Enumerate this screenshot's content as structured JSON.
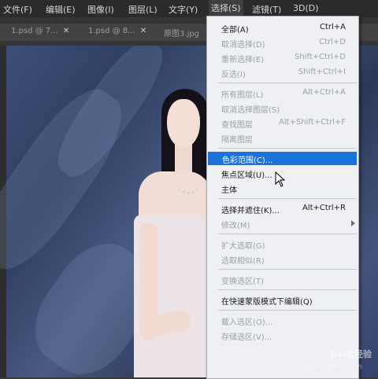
{
  "menubar": {
    "items": [
      "文件(F)",
      "编辑(E)",
      "图像(I)",
      "图层(L)",
      "文字(Y)",
      "选择(S)",
      "滤镜(T)",
      "3D(D)"
    ]
  },
  "tabs": [
    {
      "label": "1.psd @ 7..."
    },
    {
      "label": "1.psd @ 8..."
    },
    {
      "label": "原图3.jpg"
    }
  ],
  "select_menu": {
    "groups": [
      [
        {
          "label": "全部(A)",
          "shortcut": "Ctrl+A",
          "disabled": false
        },
        {
          "label": "取消选择(D)",
          "shortcut": "Ctrl+D",
          "disabled": true
        },
        {
          "label": "重新选择(E)",
          "shortcut": "Shift+Ctrl+D",
          "disabled": true
        },
        {
          "label": "反选(I)",
          "shortcut": "Shift+Ctrl+I",
          "disabled": true
        }
      ],
      [
        {
          "label": "所有图层(L)",
          "shortcut": "Alt+Ctrl+A",
          "disabled": true
        },
        {
          "label": "取消选择图层(S)",
          "shortcut": "",
          "disabled": true
        },
        {
          "label": "查找图层",
          "shortcut": "Alt+Shift+Ctrl+F",
          "disabled": true
        },
        {
          "label": "隔离图层",
          "shortcut": "",
          "disabled": true
        }
      ],
      [
        {
          "label": "色彩范围(C)...",
          "shortcut": "",
          "disabled": false,
          "selected": true
        },
        {
          "label": "焦点区域(U)...",
          "shortcut": "",
          "disabled": false
        },
        {
          "label": "主体",
          "shortcut": "",
          "disabled": false
        }
      ],
      [
        {
          "label": "选择并遮住(K)...",
          "shortcut": "Alt+Ctrl+R",
          "disabled": false
        },
        {
          "label": "修改(M)",
          "shortcut": "",
          "disabled": true,
          "submenu": true
        }
      ],
      [
        {
          "label": "扩大选取(G)",
          "shortcut": "",
          "disabled": true
        },
        {
          "label": "选取相似(R)",
          "shortcut": "",
          "disabled": true
        }
      ],
      [
        {
          "label": "变换选区(T)",
          "shortcut": "",
          "disabled": true
        }
      ],
      [
        {
          "label": "在快速蒙版模式下编辑(Q)",
          "shortcut": "",
          "disabled": false
        }
      ],
      [
        {
          "label": "载入选区(O)...",
          "shortcut": "",
          "disabled": true
        },
        {
          "label": "存储选区(V)...",
          "shortcut": "",
          "disabled": true
        }
      ]
    ]
  },
  "watermark": {
    "text": "Bai度经验",
    "sub": "jingyan.baidu.com"
  },
  "colors": {
    "highlight": "#1a73d9",
    "menu_bg": "#eef0f3",
    "menubar_bg": "#2b2b2b"
  }
}
